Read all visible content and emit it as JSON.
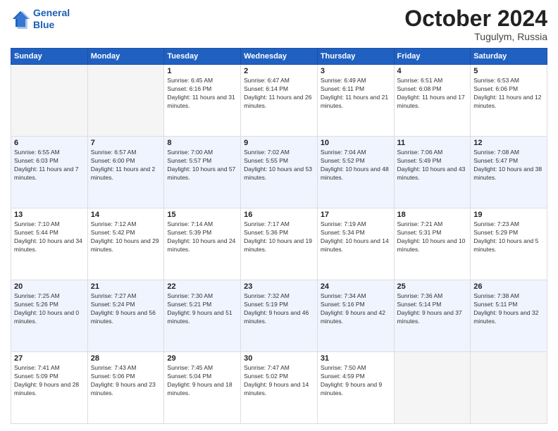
{
  "header": {
    "logo_line1": "General",
    "logo_line2": "Blue",
    "month": "October 2024",
    "location": "Tugulym, Russia"
  },
  "weekdays": [
    "Sunday",
    "Monday",
    "Tuesday",
    "Wednesday",
    "Thursday",
    "Friday",
    "Saturday"
  ],
  "weeks": [
    [
      {
        "day": "",
        "sunrise": "",
        "sunset": "",
        "daylight": ""
      },
      {
        "day": "",
        "sunrise": "",
        "sunset": "",
        "daylight": ""
      },
      {
        "day": "1",
        "sunrise": "Sunrise: 6:45 AM",
        "sunset": "Sunset: 6:16 PM",
        "daylight": "Daylight: 11 hours and 31 minutes."
      },
      {
        "day": "2",
        "sunrise": "Sunrise: 6:47 AM",
        "sunset": "Sunset: 6:14 PM",
        "daylight": "Daylight: 11 hours and 26 minutes."
      },
      {
        "day": "3",
        "sunrise": "Sunrise: 6:49 AM",
        "sunset": "Sunset: 6:11 PM",
        "daylight": "Daylight: 11 hours and 21 minutes."
      },
      {
        "day": "4",
        "sunrise": "Sunrise: 6:51 AM",
        "sunset": "Sunset: 6:08 PM",
        "daylight": "Daylight: 11 hours and 17 minutes."
      },
      {
        "day": "5",
        "sunrise": "Sunrise: 6:53 AM",
        "sunset": "Sunset: 6:06 PM",
        "daylight": "Daylight: 11 hours and 12 minutes."
      }
    ],
    [
      {
        "day": "6",
        "sunrise": "Sunrise: 6:55 AM",
        "sunset": "Sunset: 6:03 PM",
        "daylight": "Daylight: 11 hours and 7 minutes."
      },
      {
        "day": "7",
        "sunrise": "Sunrise: 6:57 AM",
        "sunset": "Sunset: 6:00 PM",
        "daylight": "Daylight: 11 hours and 2 minutes."
      },
      {
        "day": "8",
        "sunrise": "Sunrise: 7:00 AM",
        "sunset": "Sunset: 5:57 PM",
        "daylight": "Daylight: 10 hours and 57 minutes."
      },
      {
        "day": "9",
        "sunrise": "Sunrise: 7:02 AM",
        "sunset": "Sunset: 5:55 PM",
        "daylight": "Daylight: 10 hours and 53 minutes."
      },
      {
        "day": "10",
        "sunrise": "Sunrise: 7:04 AM",
        "sunset": "Sunset: 5:52 PM",
        "daylight": "Daylight: 10 hours and 48 minutes."
      },
      {
        "day": "11",
        "sunrise": "Sunrise: 7:06 AM",
        "sunset": "Sunset: 5:49 PM",
        "daylight": "Daylight: 10 hours and 43 minutes."
      },
      {
        "day": "12",
        "sunrise": "Sunrise: 7:08 AM",
        "sunset": "Sunset: 5:47 PM",
        "daylight": "Daylight: 10 hours and 38 minutes."
      }
    ],
    [
      {
        "day": "13",
        "sunrise": "Sunrise: 7:10 AM",
        "sunset": "Sunset: 5:44 PM",
        "daylight": "Daylight: 10 hours and 34 minutes."
      },
      {
        "day": "14",
        "sunrise": "Sunrise: 7:12 AM",
        "sunset": "Sunset: 5:42 PM",
        "daylight": "Daylight: 10 hours and 29 minutes."
      },
      {
        "day": "15",
        "sunrise": "Sunrise: 7:14 AM",
        "sunset": "Sunset: 5:39 PM",
        "daylight": "Daylight: 10 hours and 24 minutes."
      },
      {
        "day": "16",
        "sunrise": "Sunrise: 7:17 AM",
        "sunset": "Sunset: 5:36 PM",
        "daylight": "Daylight: 10 hours and 19 minutes."
      },
      {
        "day": "17",
        "sunrise": "Sunrise: 7:19 AM",
        "sunset": "Sunset: 5:34 PM",
        "daylight": "Daylight: 10 hours and 14 minutes."
      },
      {
        "day": "18",
        "sunrise": "Sunrise: 7:21 AM",
        "sunset": "Sunset: 5:31 PM",
        "daylight": "Daylight: 10 hours and 10 minutes."
      },
      {
        "day": "19",
        "sunrise": "Sunrise: 7:23 AM",
        "sunset": "Sunset: 5:29 PM",
        "daylight": "Daylight: 10 hours and 5 minutes."
      }
    ],
    [
      {
        "day": "20",
        "sunrise": "Sunrise: 7:25 AM",
        "sunset": "Sunset: 5:26 PM",
        "daylight": "Daylight: 10 hours and 0 minutes."
      },
      {
        "day": "21",
        "sunrise": "Sunrise: 7:27 AM",
        "sunset": "Sunset: 5:24 PM",
        "daylight": "Daylight: 9 hours and 56 minutes."
      },
      {
        "day": "22",
        "sunrise": "Sunrise: 7:30 AM",
        "sunset": "Sunset: 5:21 PM",
        "daylight": "Daylight: 9 hours and 51 minutes."
      },
      {
        "day": "23",
        "sunrise": "Sunrise: 7:32 AM",
        "sunset": "Sunset: 5:19 PM",
        "daylight": "Daylight: 9 hours and 46 minutes."
      },
      {
        "day": "24",
        "sunrise": "Sunrise: 7:34 AM",
        "sunset": "Sunset: 5:16 PM",
        "daylight": "Daylight: 9 hours and 42 minutes."
      },
      {
        "day": "25",
        "sunrise": "Sunrise: 7:36 AM",
        "sunset": "Sunset: 5:14 PM",
        "daylight": "Daylight: 9 hours and 37 minutes."
      },
      {
        "day": "26",
        "sunrise": "Sunrise: 7:38 AM",
        "sunset": "Sunset: 5:11 PM",
        "daylight": "Daylight: 9 hours and 32 minutes."
      }
    ],
    [
      {
        "day": "27",
        "sunrise": "Sunrise: 7:41 AM",
        "sunset": "Sunset: 5:09 PM",
        "daylight": "Daylight: 9 hours and 28 minutes."
      },
      {
        "day": "28",
        "sunrise": "Sunrise: 7:43 AM",
        "sunset": "Sunset: 5:06 PM",
        "daylight": "Daylight: 9 hours and 23 minutes."
      },
      {
        "day": "29",
        "sunrise": "Sunrise: 7:45 AM",
        "sunset": "Sunset: 5:04 PM",
        "daylight": "Daylight: 9 hours and 18 minutes."
      },
      {
        "day": "30",
        "sunrise": "Sunrise: 7:47 AM",
        "sunset": "Sunset: 5:02 PM",
        "daylight": "Daylight: 9 hours and 14 minutes."
      },
      {
        "day": "31",
        "sunrise": "Sunrise: 7:50 AM",
        "sunset": "Sunset: 4:59 PM",
        "daylight": "Daylight: 9 hours and 9 minutes."
      },
      {
        "day": "",
        "sunrise": "",
        "sunset": "",
        "daylight": ""
      },
      {
        "day": "",
        "sunrise": "",
        "sunset": "",
        "daylight": ""
      }
    ]
  ]
}
